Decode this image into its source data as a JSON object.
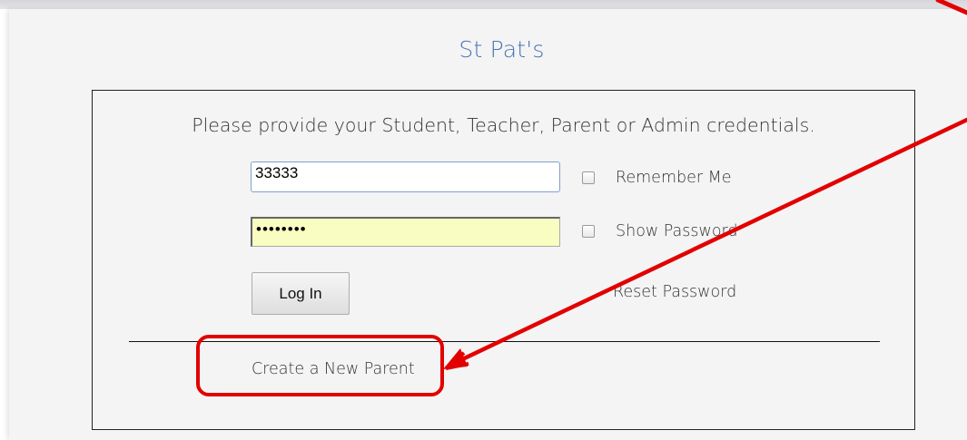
{
  "site": {
    "title": "St Pat's"
  },
  "login": {
    "prompt": "Please provide your Student, Teacher, Parent or Admin credentials.",
    "username_value": "33333",
    "password_masked": "••••••••",
    "remember_label": "Remember Me",
    "show_password_label": "Show Password",
    "login_button_label": "Log In",
    "reset_link_label": "Reset Password",
    "create_parent_label": "Create a New Parent"
  },
  "annotation": {
    "color": "#e20000"
  }
}
